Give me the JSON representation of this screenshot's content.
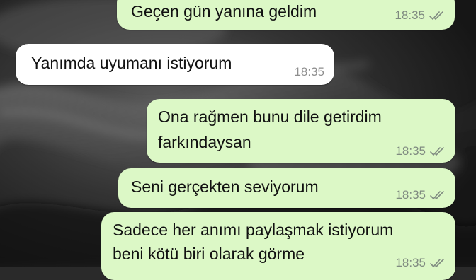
{
  "messages": [
    {
      "id": "m1",
      "direction": "outgoing",
      "lines": [
        "Geçen gün yanına geldim"
      ],
      "time": "18:35",
      "status": "read-ticks-icon"
    },
    {
      "id": "m2",
      "direction": "incoming",
      "lines": [
        "Yanımda uyumanı istiyorum"
      ],
      "time": "18:35"
    },
    {
      "id": "m3",
      "direction": "outgoing",
      "lines": [
        "Ona rağmen bunu dile getirdim",
        "farkındaysan"
      ],
      "time": "18:35",
      "status": "read-ticks-icon"
    },
    {
      "id": "m4",
      "direction": "outgoing",
      "lines": [
        "Seni gerçekten seviyorum"
      ],
      "time": "18:35",
      "status": "read-ticks-icon"
    },
    {
      "id": "m5",
      "direction": "outgoing",
      "lines": [
        "Sadece her anımı paylaşmak istiyorum",
        "beni kötü biri olarak görme"
      ],
      "time": "18:35",
      "status": "read-ticks-icon"
    }
  ],
  "colors": {
    "outgoing_bubble": "#dcf8c6",
    "incoming_bubble": "#ffffff",
    "wallpaper": "#2a2a2a"
  }
}
